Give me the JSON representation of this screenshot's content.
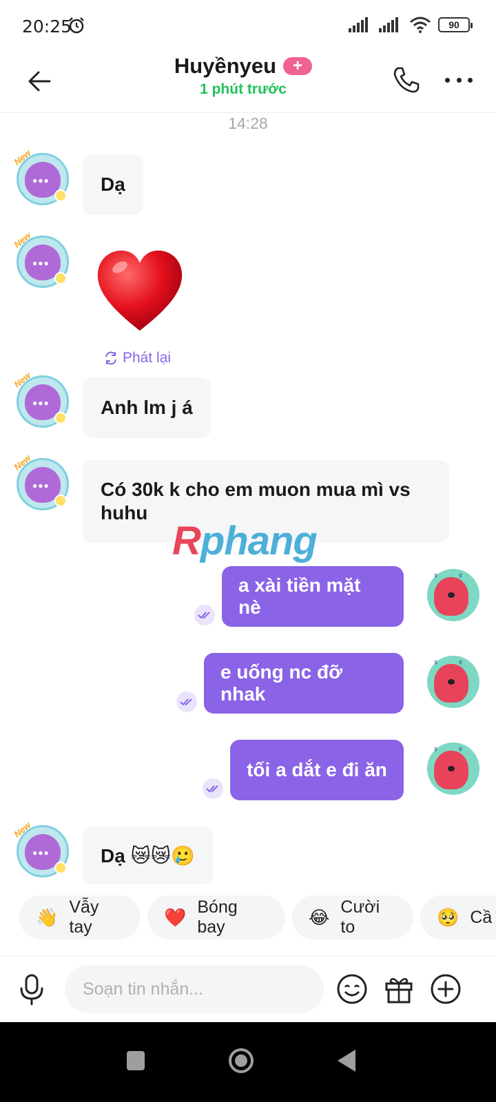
{
  "status_bar": {
    "time": "20:25",
    "battery": "90"
  },
  "header": {
    "contact_name": "Huyềnyeu",
    "add_badge": "+",
    "last_seen": "1 phút trước"
  },
  "conversation": {
    "timestamp": "14:28",
    "messages": [
      {
        "from": "contact",
        "text": "Dạ"
      },
      {
        "from": "contact",
        "type": "sticker",
        "sticker": "heart-sticker",
        "replay_label": "Phát lại"
      },
      {
        "from": "contact",
        "text": "Anh lm j á"
      },
      {
        "from": "contact",
        "text": "Có 30k k cho em muon mua mì vs huhu"
      },
      {
        "from": "me",
        "text": "a xài tiền mặt nè",
        "status": "seen"
      },
      {
        "from": "me",
        "text": "e uống nc đỡ nhak",
        "status": "seen"
      },
      {
        "from": "me",
        "text": "tối a dắt e đi ăn",
        "status": "seen"
      },
      {
        "from": "contact",
        "text": "Dạ 😿😿🥲"
      }
    ]
  },
  "watermark": {
    "part1": "R",
    "part2": "phang"
  },
  "quick_replies": [
    {
      "emoji": "👋",
      "label": "Vẫy tay"
    },
    {
      "emoji": "❤️",
      "label": "Bóng bay"
    },
    {
      "emoji": "😂",
      "label": "Cười to"
    },
    {
      "emoji": "🥺",
      "label": "Cầ"
    }
  ],
  "composer": {
    "placeholder": "Soạn tin nhắn..."
  },
  "colors": {
    "accent": "#8a63e6",
    "online": "#20c15a",
    "badge": "#f06292"
  }
}
